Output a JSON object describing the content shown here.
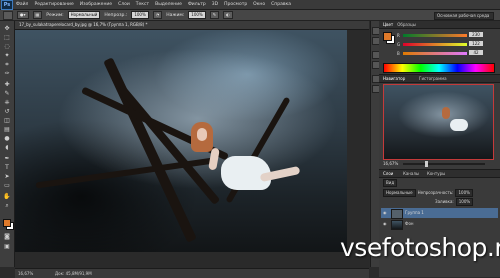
{
  "app": {
    "logo_text": "Ps",
    "menu": [
      "Файл",
      "Редактирование",
      "Изображение",
      "Слои",
      "Текст",
      "Выделение",
      "Фильтр",
      "3D",
      "Просмотр",
      "Окно",
      "Справка"
    ]
  },
  "options": {
    "mode_label": "Режим:",
    "mode_value": "Нормальный",
    "opacity_label": "Непрозр.:",
    "opacity_value": "100%",
    "flow_label": "Нажим:",
    "flow_value": "100%",
    "workspace": "Основная рабочая среда"
  },
  "document": {
    "tab_title": "17_by_sulakatraperelocard_by.jpg @ 16,7% (Группа 1, RGB/8) *",
    "zoom": "16,67%",
    "doc_info": "Док: 45,8M/91,9M"
  },
  "right_panel": {
    "color_tabs": [
      "Цвет",
      "Образцы"
    ],
    "color": {
      "sliders": [
        {
          "letter": "R",
          "value": "230"
        },
        {
          "letter": "G",
          "value": "122"
        },
        {
          "letter": "B",
          "value": "42"
        }
      ]
    },
    "navigator_tabs": [
      "Навигатор",
      "Гистограмма"
    ],
    "navigator_zoom": "16,67%",
    "layers_tabs": [
      "Слои",
      "Каналы",
      "Контуры"
    ],
    "layers": {
      "filter": "Вид",
      "blend": "Нормальные",
      "opacity_label": "Непрозрачность:",
      "opacity_value": "100%",
      "fill_label": "Заливка:",
      "fill_value": "100%",
      "items": [
        {
          "name": "Группа 1"
        },
        {
          "name": "Фон"
        }
      ]
    }
  },
  "watermark": "vsefotoshop.ru",
  "colors": {
    "foreground": "#e07a2a",
    "background": "#ffffff",
    "navigator_frame": "#c43a3a"
  }
}
